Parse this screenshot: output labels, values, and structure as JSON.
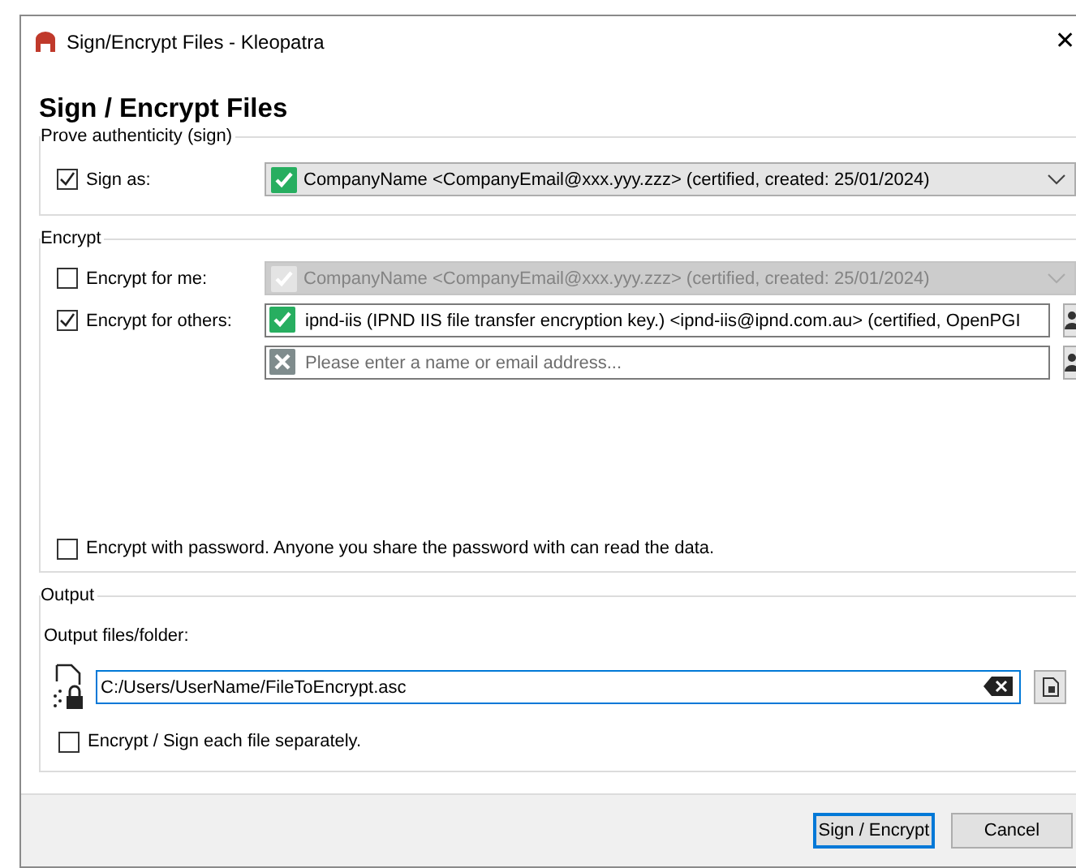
{
  "window": {
    "title": "Sign/Encrypt Files - Kleopatra",
    "close": "✕"
  },
  "heading": "Sign / Encrypt Files",
  "sign_group": {
    "legend": "Prove authenticity (sign)",
    "label": "Sign as:",
    "checked": true,
    "key": "CompanyName <CompanyEmail@xxx.yyy.zzz> (certified, created: 25/01/2024)"
  },
  "encrypt_group": {
    "legend": "Encrypt",
    "rows": [
      {
        "kind": "combo",
        "label": "Encrypt for me:",
        "checked": false,
        "disabled": true,
        "text": "CompanyName <CompanyEmail@xxx.yyy.zzz> (certified, created: 25/01/2024)"
      },
      {
        "kind": "recipient",
        "label": "Encrypt for others:",
        "checked": true,
        "valid": true,
        "text": "ipnd-iis (IPND IIS file transfer encryption key.) <ipnd-iis@ipnd.com.au> (certified, OpenPGI"
      },
      {
        "kind": "recipient",
        "valid": false,
        "placeholder": "Please enter a name or email address..."
      }
    ],
    "password": {
      "label": "Encrypt with password. Anyone you share the password with can read the data.",
      "checked": false
    }
  },
  "output": {
    "legend": "Output",
    "label": "Output files/folder:",
    "path": "C:/Users/UserName/FileToEncrypt.asc",
    "separately": {
      "label": "Encrypt / Sign each file separately.",
      "checked": false
    }
  },
  "buttons": [
    {
      "label": "Sign / Encrypt",
      "default": true
    },
    {
      "label": "Cancel",
      "default": false
    }
  ]
}
